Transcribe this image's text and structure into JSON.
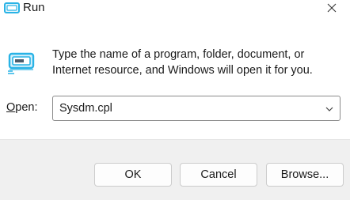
{
  "window": {
    "title": "Run",
    "close_icon": "close-icon",
    "title_icon": "run-icon"
  },
  "main": {
    "icon": "run-icon",
    "description_line1": "Type the name of a program, folder, document, or",
    "description_line2": "Internet resource, and Windows will open it for you.",
    "open_label_mnemonic": "O",
    "open_label_rest": "pen:",
    "input_value": "Sysdm.cpl",
    "dropdown_icon": "chevron-down-icon"
  },
  "buttons": {
    "ok": "OK",
    "cancel": "Cancel",
    "browse": "Browse..."
  },
  "colors": {
    "icon_accent": "#29b3e6",
    "icon_dark": "#2c3e50",
    "footer_bg": "#f0f0f0"
  }
}
